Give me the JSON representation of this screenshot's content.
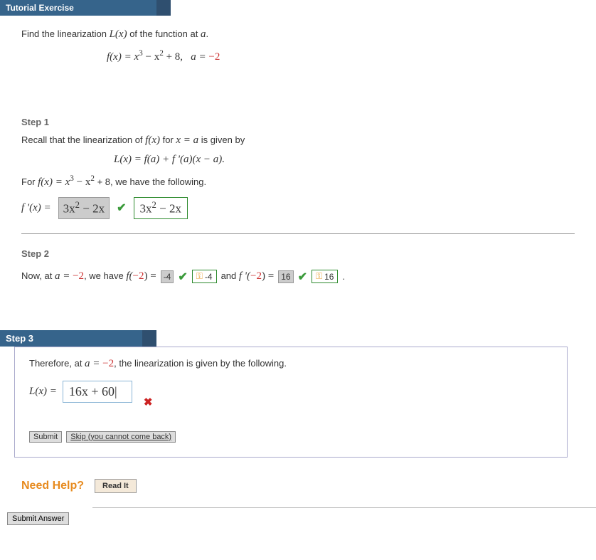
{
  "header": {
    "title": "Tutorial Exercise"
  },
  "problem": {
    "prompt_pre": "Find the linearization ",
    "prompt_lx": "L(x)",
    "prompt_post": " of the function at ",
    "prompt_a": "a",
    "formula_f": "f(x) = x",
    "formula_rest": " − x",
    "formula_tail": " + 8,",
    "a_eq": "a = ",
    "a_val": "−2"
  },
  "step1": {
    "label": "Step 1",
    "recall_pre": "Recall that the linearization of ",
    "recall_fx": "f(x)",
    "recall_mid": " for ",
    "recall_xa": "x = a",
    "recall_post": " is given by",
    "formula": "L(x) = f(a) + f '(a)(x − a).",
    "for_pre": "For ",
    "for_fx": "f(x) = x",
    "for_rest": " − x",
    "for_tail": " + 8, we have the following.",
    "fprime": "f '(x) = ",
    "locked": "3x",
    "locked_tail": " − 2x",
    "green": "3x",
    "green_tail": " − 2x"
  },
  "step2": {
    "label": "Step 2",
    "pre": "Now, at ",
    "a_eq": "a = ",
    "a_val": "−2",
    "mid": ", we have ",
    "f_eq": "f(",
    "neg2": "−2",
    "f_close": ") = ",
    "ans1": "-4",
    "key1": "-4",
    "and": " and ",
    "fp_eq": "f '(",
    "fp_close": ") = ",
    "ans2": "16",
    "key2": "16"
  },
  "step3": {
    "label": "Step 3",
    "pre": "Therefore, at ",
    "a_eq": "a = ",
    "a_val": "−2",
    "post": ", the linearization is given by the following.",
    "lx": "L(x) = ",
    "input": "16x + 60|",
    "submit": "Submit",
    "skip": "Skip (you cannot come back)"
  },
  "help": {
    "label": "Need Help?",
    "readit": "Read It"
  },
  "footer": {
    "submit": "Submit Answer"
  }
}
